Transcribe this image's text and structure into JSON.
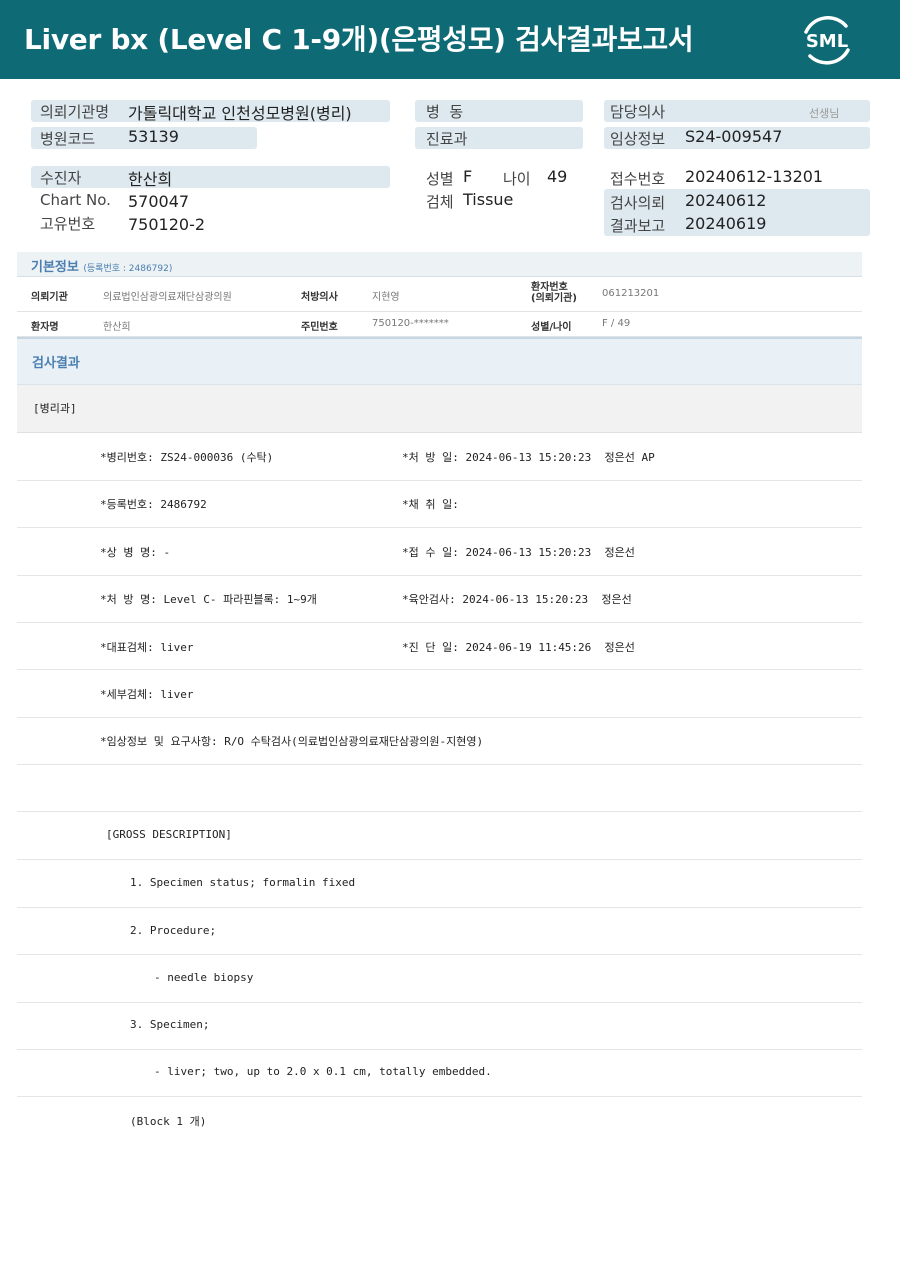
{
  "header": {
    "title": "Liver bx (Level C 1-9개)(은평성모) 검사결과보고서",
    "logo_text": "SML"
  },
  "info": {
    "institution_label": "의뢰기관명",
    "institution_value": "가톨릭대학교 인천성모병원(병리)",
    "hospital_code_label": "병원코드",
    "hospital_code_value": "53139",
    "ward_label": "병  동",
    "ward_value": "",
    "dept_label": "진료과",
    "dept_value": "",
    "doctor_label": "담당의사",
    "doctor_value": "",
    "doctor_suffix": "선생님",
    "clinical_label": "임상정보",
    "clinical_value": "S24-009547",
    "patient_label": "수진자",
    "patient_value": "한산희",
    "chart_label": "Chart No.",
    "chart_value": "570047",
    "unique_label": "고유번호",
    "unique_value": "750120-2",
    "sex_label": "성별",
    "sex_value": "F",
    "age_label": "나이",
    "age_value": "49",
    "specimen_label": "검체",
    "specimen_value": "Tissue",
    "receipt_label": "접수번호",
    "receipt_value": "20240612-13201",
    "request_label": "검사의뢰",
    "request_value": "20240612",
    "report_label": "결과보고",
    "report_value": "20240619"
  },
  "basic": {
    "title": "기본정보",
    "subtitle": "(등록번호 : 2486792)",
    "row1": {
      "inst_label": "의뢰기관",
      "inst_value": "의료법인삼광의료재단삼광의원",
      "presc_label": "처방의사",
      "presc_value": "지현영",
      "pid_label_1": "환자번호",
      "pid_label_2": "(의뢰기관)",
      "pid_value": "061213201"
    },
    "row2": {
      "name_label": "환자명",
      "name_value": "한산희",
      "rrn_label": "주민번호",
      "rrn_value": "750120-*******",
      "sexage_label": "성별/나이",
      "sexage_value": "F / 49"
    }
  },
  "results": {
    "title": "검사결과",
    "department": "[병리과]",
    "left": [
      "*병리번호: ZS24-000036 (수탁)",
      "*등록번호: 2486792",
      "*상 병 명: -",
      "*처 방 명: Level C- 파라핀블록: 1~9개",
      "*대표검체: liver",
      "*세부검체: liver",
      "*임상정보 및 요구사항: R/O 수탁검사(의료법인삼광의료재단삼광의원-지현영)"
    ],
    "right": [
      "*처 방 일: 2024-06-13 15:20:23  정은선 AP",
      "*채 취 일:",
      "*접 수 일: 2024-06-13 15:20:23  정은선",
      "*육안검사: 2024-06-13 15:20:23  정은선",
      "*진 단 일: 2024-06-19 11:45:26  정은선"
    ],
    "gross_heading": "[GROSS DESCRIPTION]",
    "gross": [
      "1. Specimen status; formalin fixed",
      "2. Procedure;",
      "- needle biopsy",
      "3. Specimen;",
      "- liver; two, up to 2.0 x 0.1 cm, totally embedded.",
      "(Block 1 개)"
    ]
  }
}
